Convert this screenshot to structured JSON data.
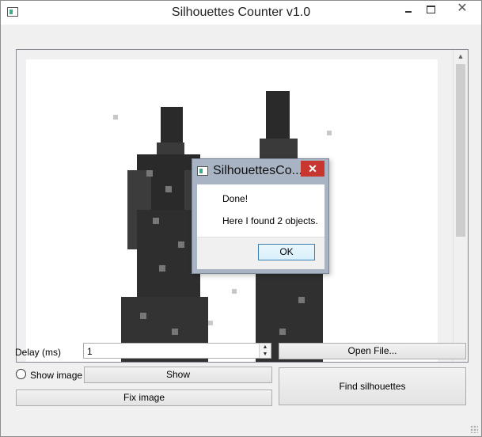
{
  "window": {
    "title": "Silhouettes Counter v1.0",
    "close_glyph": "✕"
  },
  "controls": {
    "delay_label": "Delay (ms)",
    "delay_value": "1",
    "show_image_label": "Show image",
    "show_button": "Show",
    "fix_image_button": "Fix image",
    "open_file_button": "Open File...",
    "find_silhouettes_button": "Find silhouettes"
  },
  "dialog": {
    "title": "SilhouettesCo...",
    "close_glyph": "✕",
    "message_line1": "Done!",
    "message_line2": "Here I found 2 objects.",
    "ok_button": "OK"
  },
  "icons": {
    "spin_up": "▲",
    "spin_down": "▼",
    "scroll_up": "▲",
    "scroll_down": "▼"
  },
  "colors": {
    "close_button": "#c7372f",
    "dialog_frame": "#a8b4c4",
    "ok_button_border": "#3c7fb1"
  }
}
